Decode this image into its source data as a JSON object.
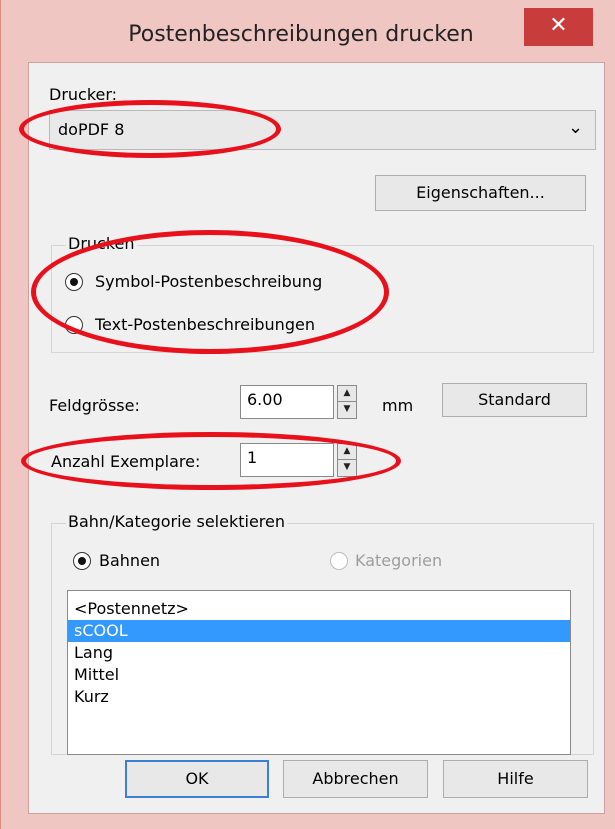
{
  "window": {
    "title": "Postenbeschreibungen drucken",
    "close_glyph": "✕"
  },
  "printer": {
    "label": "Drucker:",
    "selected": "doPDF 8",
    "properties_button": "Eigenschaften..."
  },
  "print_group": {
    "title": "Drucken",
    "options": [
      {
        "label": "Symbol-Postenbeschreibung",
        "checked": true
      },
      {
        "label": "Text-Postenbeschreibungen",
        "checked": false
      }
    ]
  },
  "field_size": {
    "label": "Feldgrösse:",
    "value": "6.00",
    "unit": "mm",
    "standard_button": "Standard"
  },
  "copies": {
    "label": "Anzahl Exemplare:",
    "value": "1"
  },
  "course_group": {
    "title": "Bahn/Kategorie selektieren",
    "options": [
      {
        "label": "Bahnen",
        "checked": true,
        "enabled": true
      },
      {
        "label": "Kategorien",
        "checked": false,
        "enabled": false
      }
    ],
    "items": [
      "<Postennetz>",
      "sCOOL",
      "Lang",
      "Mittel",
      "Kurz"
    ],
    "selected_index": 1
  },
  "buttons": {
    "ok": "OK",
    "cancel": "Abbrechen",
    "help": "Hilfe"
  },
  "colors": {
    "annotation": "#e8101a",
    "selection": "#3399ff",
    "close_button": "#c83c3c"
  }
}
